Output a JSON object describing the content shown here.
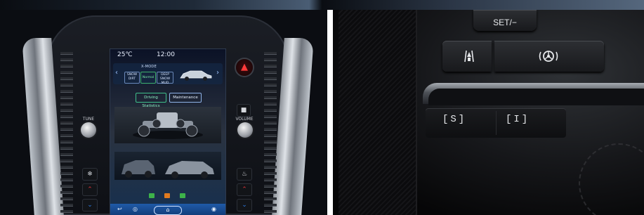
{
  "left_photo": {
    "screen": {
      "temperature": "25℃",
      "clock": "12:00",
      "drive_mode_logo": "X-MODE",
      "modes": [
        "SNOW DIRT",
        "Normal",
        "DEEP SNOW MUD"
      ],
      "tabs": [
        "Driving Statistics",
        "Maintenance"
      ],
      "dock_icons": [
        "back-icon",
        "camera-icon",
        "home-icon",
        "person-icon"
      ]
    },
    "controls": {
      "tune_knob_label": "TUNE",
      "volume_knob_label": "VOLUME",
      "hazard_icon": "hazard-icon",
      "climate_buttons_left": [
        "fan-icon",
        "temp-up-icon",
        "temp-down-icon"
      ],
      "climate_buttons_right": [
        "defrost-icon",
        "temp-up-icon",
        "temp-down-icon"
      ]
    },
    "colors": {
      "screen_blue": "#1f5aa8",
      "accent_green": "#3fbf8a",
      "hazard_red": "#ff3a3a"
    }
  },
  "right_photo": {
    "set_button_label": "SET/−",
    "lane_keep_icon": "lane-keep-icon",
    "adaptive_cruise_icon": "adaptive-cruise-icon",
    "s_button_label": "[S]",
    "i_button_label": "[I]"
  }
}
